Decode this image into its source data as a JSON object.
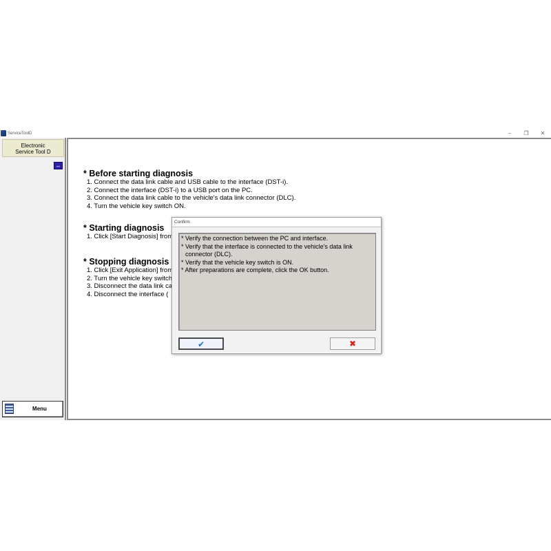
{
  "window": {
    "title": "ServiceToolD",
    "minimize": "–",
    "restore": "❐",
    "close": "✕"
  },
  "sidebar": {
    "header_line1": "Electronic",
    "header_line2": "Service Tool D",
    "switch_icon": "↔",
    "menu_label": "Menu"
  },
  "main": {
    "sections": [
      {
        "title": "* Before starting diagnosis",
        "items": [
          "1. Connect the data link cable and USB cable to the interface (DST-i).",
          "2. Connect the interface (DST-i) to a USB port on the PC.",
          "3. Connect the data link cable to the vehicle's data link connector (DLC).",
          "4. Turn the vehicle key switch ON."
        ]
      },
      {
        "title": "* Starting diagnosis",
        "items": [
          "1. Click [Start Diagnosis] from"
        ]
      },
      {
        "title": "* Stopping diagnosis",
        "items": [
          "1. Click [Exit Application] from",
          "2. Turn the vehicle key switch",
          "3. Disconnect the data link ca",
          "4. Disconnect the interface ("
        ]
      }
    ]
  },
  "dialog": {
    "title": "Confirm",
    "lines": [
      "* Verify the connection between the PC and interface.",
      "* Verify that the interface is connected to the vehicle's data link",
      "connector (DLC).",
      "* Verify that the vehicle key switch is ON.",
      "* After preparations are complete, click the OK button."
    ],
    "ok_icon": "✔",
    "cancel_icon": "✖"
  },
  "colors": {
    "ok_check": "#1d6fd1",
    "cancel_x": "#d2231c",
    "switch_icon_bg": "#2c1fa8",
    "sidebar_header_bg": "#ecebd2"
  }
}
